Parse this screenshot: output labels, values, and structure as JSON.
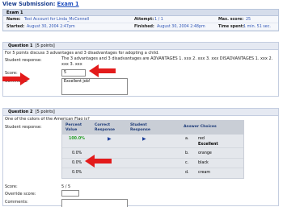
{
  "header": {
    "title_prefix": "View Submission:",
    "title_link": "Exam 1"
  },
  "exam": {
    "heading": "Exam 1",
    "name_label": "Name:",
    "name_value": "Test Account for Linda_McConnell",
    "attempt_label": "Attempt:",
    "attempt_value": "1 / 1",
    "maxscore_label": "Max. score:",
    "maxscore_value": "25",
    "started_label": "Started:",
    "started_value": "August 30, 2004 2:47pm",
    "finished_label": "Finished:",
    "finished_value": "August 30, 2004 2:48pm",
    "timespent_label": "Time spent:",
    "timespent_value": "1 min. 51 sec."
  },
  "question1": {
    "label": "Question 1",
    "points": "[5 points]",
    "prompt": "For 5 points discuss 3 advantages and 3 disadvantages for adopting a child.",
    "response_label": "Student response:",
    "response_text": "The 3 advantages and 3 disadvantages are ADVANTAGES 1. xxx 2. xxx 3. xxx DISADVANTAGES 1. xxx 2. xxx 3. xxx",
    "score_label": "Score:",
    "score_value": "5",
    "comments_label": "Comments:",
    "comments_value": "Excellent job!"
  },
  "question2": {
    "label": "Question 2",
    "points": "[5 points]",
    "prompt": "One of the colors of the American Flag is?",
    "response_label": "Student response:",
    "table_headers": {
      "percent": "Percent Value",
      "correct": "Correct Response",
      "student": "Student Response",
      "choices": "Answer Choices"
    },
    "rows": [
      {
        "percent": "100.0%",
        "letter": "a.",
        "choice": "red",
        "feedback": "Excellent"
      },
      {
        "percent": "0.0%",
        "letter": "b.",
        "choice": "orange",
        "feedback": ""
      },
      {
        "percent": "0.0%",
        "letter": "c.",
        "choice": "black",
        "feedback": ""
      },
      {
        "percent": "0.0%",
        "letter": "d.",
        "choice": "cream",
        "feedback": ""
      }
    ],
    "score_label": "Score:",
    "score_value": "5 / 5",
    "override_label": "Override score:",
    "comments_label": "Comments:"
  },
  "colors": {
    "link": "#1f4fbf",
    "percent_green": "#2aa02a",
    "arrow_red": "#e31b1b",
    "marker_blue": "#1d3f9a"
  },
  "icons": {
    "arrow": "red-arrow-icon",
    "correct_marker": "triangle-right-icon"
  }
}
